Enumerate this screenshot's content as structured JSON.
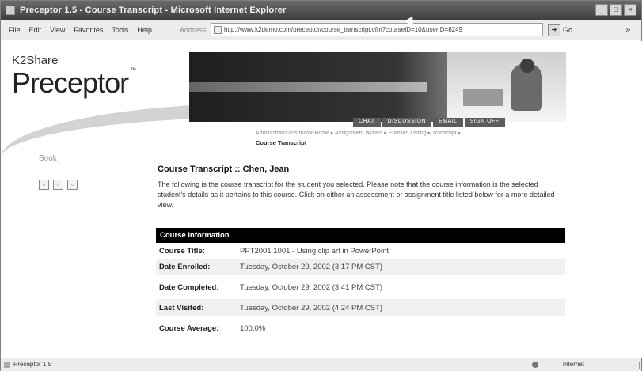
{
  "window": {
    "title": "Preceptor 1.5 - Course Transcript - Microsoft Internet Explorer",
    "controls": [
      "_",
      "□",
      "×"
    ]
  },
  "menu": {
    "items": [
      "File",
      "Edit",
      "View",
      "Favorites",
      "Tools",
      "Help"
    ],
    "address_label": "Address",
    "address_value": "http://www.k2demo.com/preceptor/course_transcript.cfm?courseID=10&userID=8249",
    "go_label": "Go"
  },
  "brand": {
    "company": "K2Share",
    "product": "Preceptor",
    "tm": "™"
  },
  "nav": {
    "links": [
      "CHAT",
      "DISCUSSION",
      "EMAIL",
      "SIGN OFF"
    ]
  },
  "breadcrumb": {
    "path": "Administrator/Instructor Home ▸ Assignment Wizard ▸ Enrolled Listing ▸ Transcript ▸",
    "current": "Course Transcript"
  },
  "sidebar": {
    "title": "Book",
    "icons": [
      "page-icon",
      "page-icon",
      "page-icon"
    ]
  },
  "main": {
    "title": "Course Transcript :: Chen, Jean",
    "intro": "The following is the course transcript for the student you selected. Please note that the course information is the selected student's details as it pertains to this course. Click on either an assessment or assignment title listed below for a more detailed view."
  },
  "course_info": {
    "header": "Course Information",
    "rows": [
      {
        "label": "Course Title:",
        "value": "PPT2001 1001 - Using clip art in PowerPoint"
      },
      {
        "label": "Date Enrolled:",
        "value": "Tuesday, October 29, 2002 (3:17 PM CST)"
      },
      {
        "label": "Date Completed:",
        "value": "Tuesday, October 29, 2002 (3:41 PM CST)"
      },
      {
        "label": "Last Visited:",
        "value": "Tuesday, October 29, 2002 (4:24 PM CST)"
      },
      {
        "label": "Course Average:",
        "value": "100.0%"
      }
    ]
  },
  "status": {
    "left": "Preceptor 1.5",
    "right": "Internet"
  }
}
